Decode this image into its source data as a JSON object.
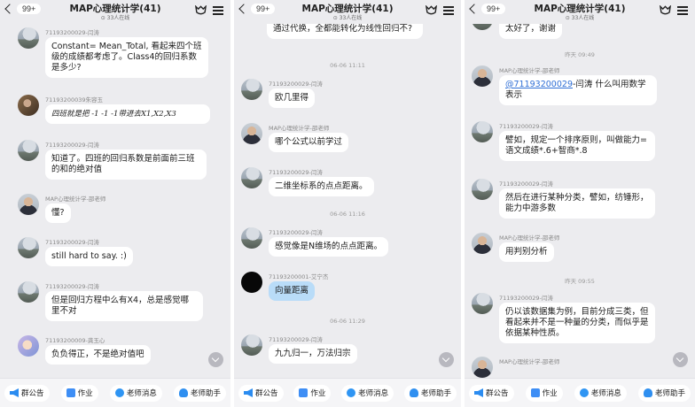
{
  "header": {
    "back_count": "99+",
    "title": "MAP心理统计学(41)",
    "online": "⊙ 33人在线"
  },
  "bottom_bar": {
    "announce": "群公告",
    "homework": "作业",
    "teacher_msg": "老师消息",
    "teacher_helper": "老师助手"
  },
  "panels": [
    {
      "messages": [
        {
          "name": "71193200029-闫涛",
          "text": "Constant= Mean_Total, 看起来四个班级的成绩都考虑了。Class4的回归系数是多少?"
        },
        {
          "name": "71193200039朱容玉",
          "text": "四班就是把 -1 -1 -1带进去X1,X2,X3"
        },
        {
          "name": "71193200029-闫涛",
          "text": "知道了。四班的回归系数是前面前三班的和的绝对值"
        },
        {
          "name": "MAP心理统计学-邵老师",
          "text": "懂?"
        },
        {
          "name": "71193200029-闫涛",
          "text": "still hard to say. :)"
        },
        {
          "name": "71193200029-闫涛",
          "text": "但是回归方程中么有X4，总是感觉哪里不对"
        },
        {
          "name": "71193200009-龚玉心",
          "text": "负负得正，不是绝对值吧"
        }
      ]
    },
    {
      "top_bubble": "通过代换，全都能转化为线性回归不?",
      "times": [
        "06-06 11:11",
        "06-06 11:16",
        "06-06 11:29"
      ],
      "messages": [
        {
          "name": "71193200029-闫涛",
          "text": "欧几里得"
        },
        {
          "name": "MAP心理统计学-邵老师",
          "text": "哪个公式以前学过"
        },
        {
          "name": "71193200029-闫涛",
          "text": "二维坐标系的点点距离。"
        },
        {
          "name": "71193200029-闫涛",
          "text": "感觉像是N维场的点点距离。"
        },
        {
          "name": "71193200001-艾宁杰",
          "text": "向量距离"
        },
        {
          "name": "71193200029-闫涛",
          "text": "九九归一，万法归宗"
        }
      ]
    },
    {
      "top_bubble": "太好了，谢谢",
      "times": [
        "昨天 09:49",
        "昨天 09:55"
      ],
      "mention": "@71193200029",
      "messages": [
        {
          "name": "MAP心理统计学-邵老师",
          "text": "-闫涛 什么叫用数学表示"
        },
        {
          "name": "71193200029-闫涛",
          "text": "譬如，规定一个排序原则，叫做能力=语文成绩*.6+智商*.8"
        },
        {
          "name": "71193200029-闫涛",
          "text": "然后在进行某种分类，譬如，纺锤形，能力中游多数"
        },
        {
          "name": "MAP心理统计学-邵老师",
          "text": "用判别分析"
        },
        {
          "name": "71193200029-闫涛",
          "text": "仍以该数据集为例，目前分成三类，但看起来并不是一种量的分类，而似乎是依据某种性质。"
        },
        {
          "name": "MAP心理统计学-邵老师",
          "text": ""
        }
      ]
    }
  ]
}
